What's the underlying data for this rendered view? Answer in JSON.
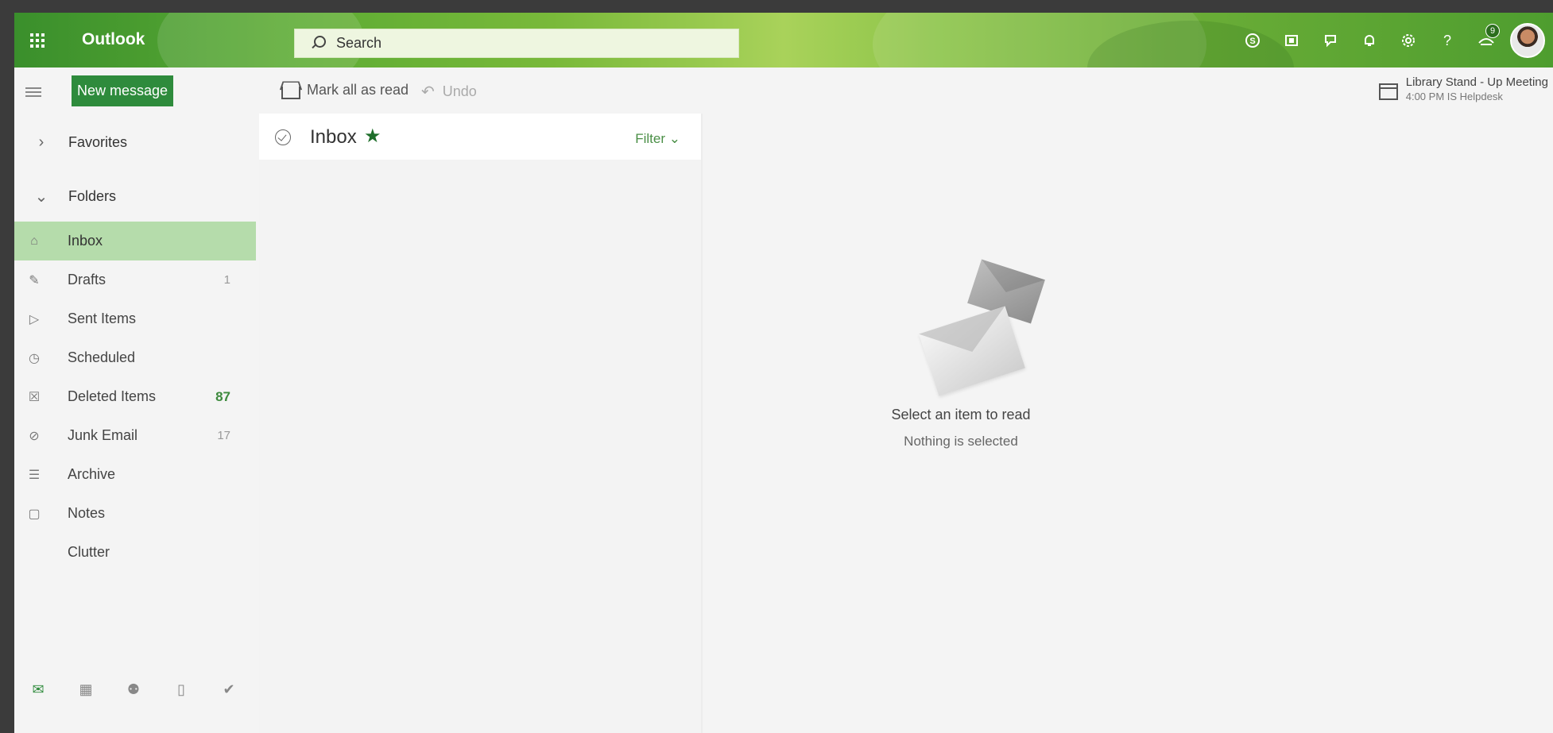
{
  "header": {
    "brand": "Outlook",
    "search": {
      "placeholder": "Search",
      "value": ""
    },
    "icons": [
      "skype-icon",
      "office-icon",
      "feedback-icon",
      "notification-bell-icon",
      "settings-gear-icon",
      "help-icon",
      "assistant-icon"
    ],
    "notification_badge": "9"
  },
  "command_bar": {
    "new_message_label": "New message",
    "mark_all_read_label": "Mark all as read",
    "undo_label": "Undo",
    "reminder": {
      "title": "Library Stand - Up Meeting",
      "subtitle": "4:00 PM IS Helpdesk"
    }
  },
  "sidebar": {
    "favorites_label": "Favorites",
    "folders_label": "Folders",
    "items": [
      {
        "label": "Inbox",
        "count": "",
        "icon": "inbox-icon",
        "active": true
      },
      {
        "label": "Drafts",
        "count": "1",
        "icon": "pencil-icon"
      },
      {
        "label": "Sent Items",
        "count": "",
        "icon": "send-icon"
      },
      {
        "label": "Scheduled",
        "count": "",
        "icon": "clock-icon"
      },
      {
        "label": "Deleted Items",
        "count": "87",
        "icon": "trash-icon"
      },
      {
        "label": "Junk Email",
        "count": "17",
        "icon": "block-icon"
      },
      {
        "label": "Archive",
        "count": "",
        "icon": "archive-icon"
      },
      {
        "label": "Notes",
        "count": "",
        "icon": "note-icon"
      },
      {
        "label": "Clutter",
        "count": "",
        "icon": ""
      }
    ],
    "app_switcher": [
      "mail-icon",
      "calendar-icon",
      "people-icon",
      "files-icon",
      "tasks-icon"
    ]
  },
  "message_list": {
    "title": "Inbox",
    "filter_label": "Filter"
  },
  "reading_pane": {
    "empty_title": "Select an item to read",
    "empty_subtitle": "Nothing is selected"
  },
  "colors": {
    "accent": "#2e8b3c",
    "active_folder": "#b5dcab",
    "count_highlight": "#3d8a3d"
  }
}
